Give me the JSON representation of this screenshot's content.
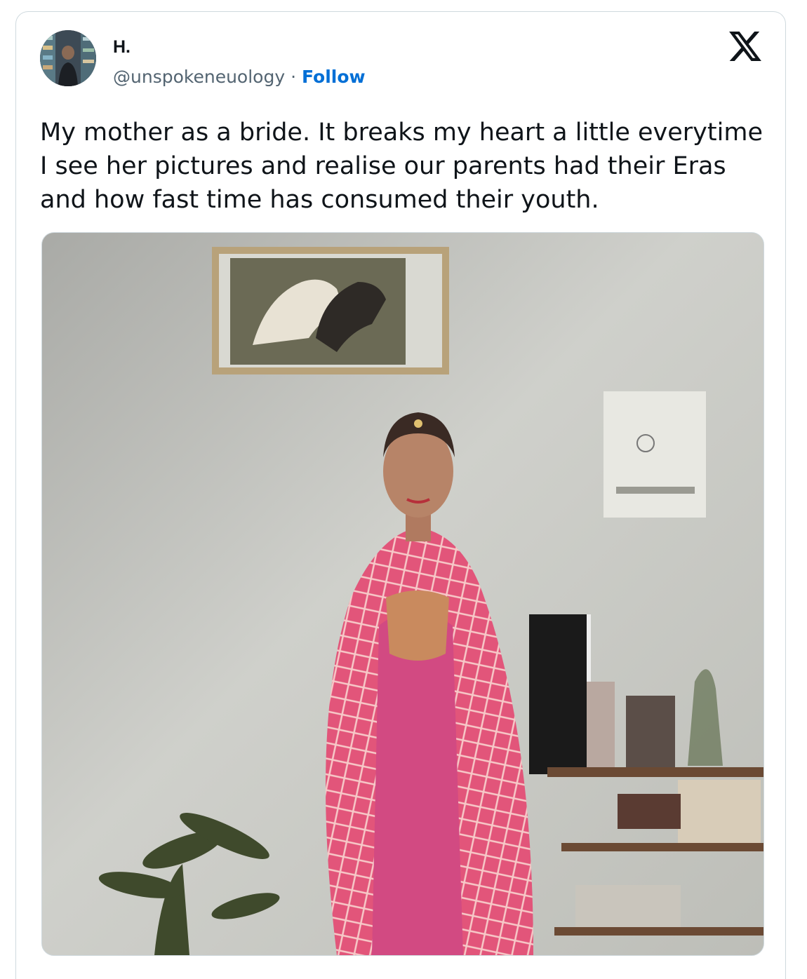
{
  "tweet": {
    "display_name": "H.",
    "handle": "@unspokeneuology",
    "separator": "·",
    "follow_label": "Follow",
    "text_lines": [
      "My mother as a bride. It breaks my heart a little everytime",
      "I see her pictures and realise our parents had their Eras",
      "and how fast time has consumed their youth."
    ]
  },
  "icons": {
    "platform_logo": "x-logo-icon",
    "avatar": "avatar"
  },
  "colors": {
    "follow_link": "#006fd6",
    "text_primary": "#0f1419",
    "text_secondary": "#536471",
    "border": "#cfd9de"
  }
}
